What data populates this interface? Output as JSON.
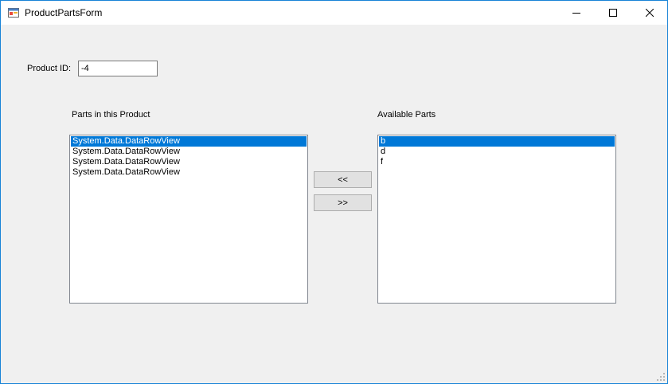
{
  "window": {
    "title": "ProductPartsForm",
    "accent": "#1883d7"
  },
  "titlebar_buttons": {
    "minimize_icon": "minimize-icon",
    "maximize_icon": "maximize-icon",
    "close_icon": "close-icon"
  },
  "form": {
    "product_id_label": "Product ID:",
    "product_id_value": "-4",
    "parts_in_product_label": "Parts in this Product",
    "available_parts_label": "Available Parts",
    "add_button_label": "<<",
    "remove_button_label": ">>"
  },
  "parts_in_product": {
    "items": [
      "System.Data.DataRowView",
      "System.Data.DataRowView",
      "System.Data.DataRowView",
      "System.Data.DataRowView"
    ],
    "selected_index": 0
  },
  "available_parts": {
    "items": [
      "b",
      "d",
      "f"
    ],
    "selected_index": 0
  },
  "colors": {
    "selection": "#0078d7",
    "form_background": "#f0f0f0"
  }
}
